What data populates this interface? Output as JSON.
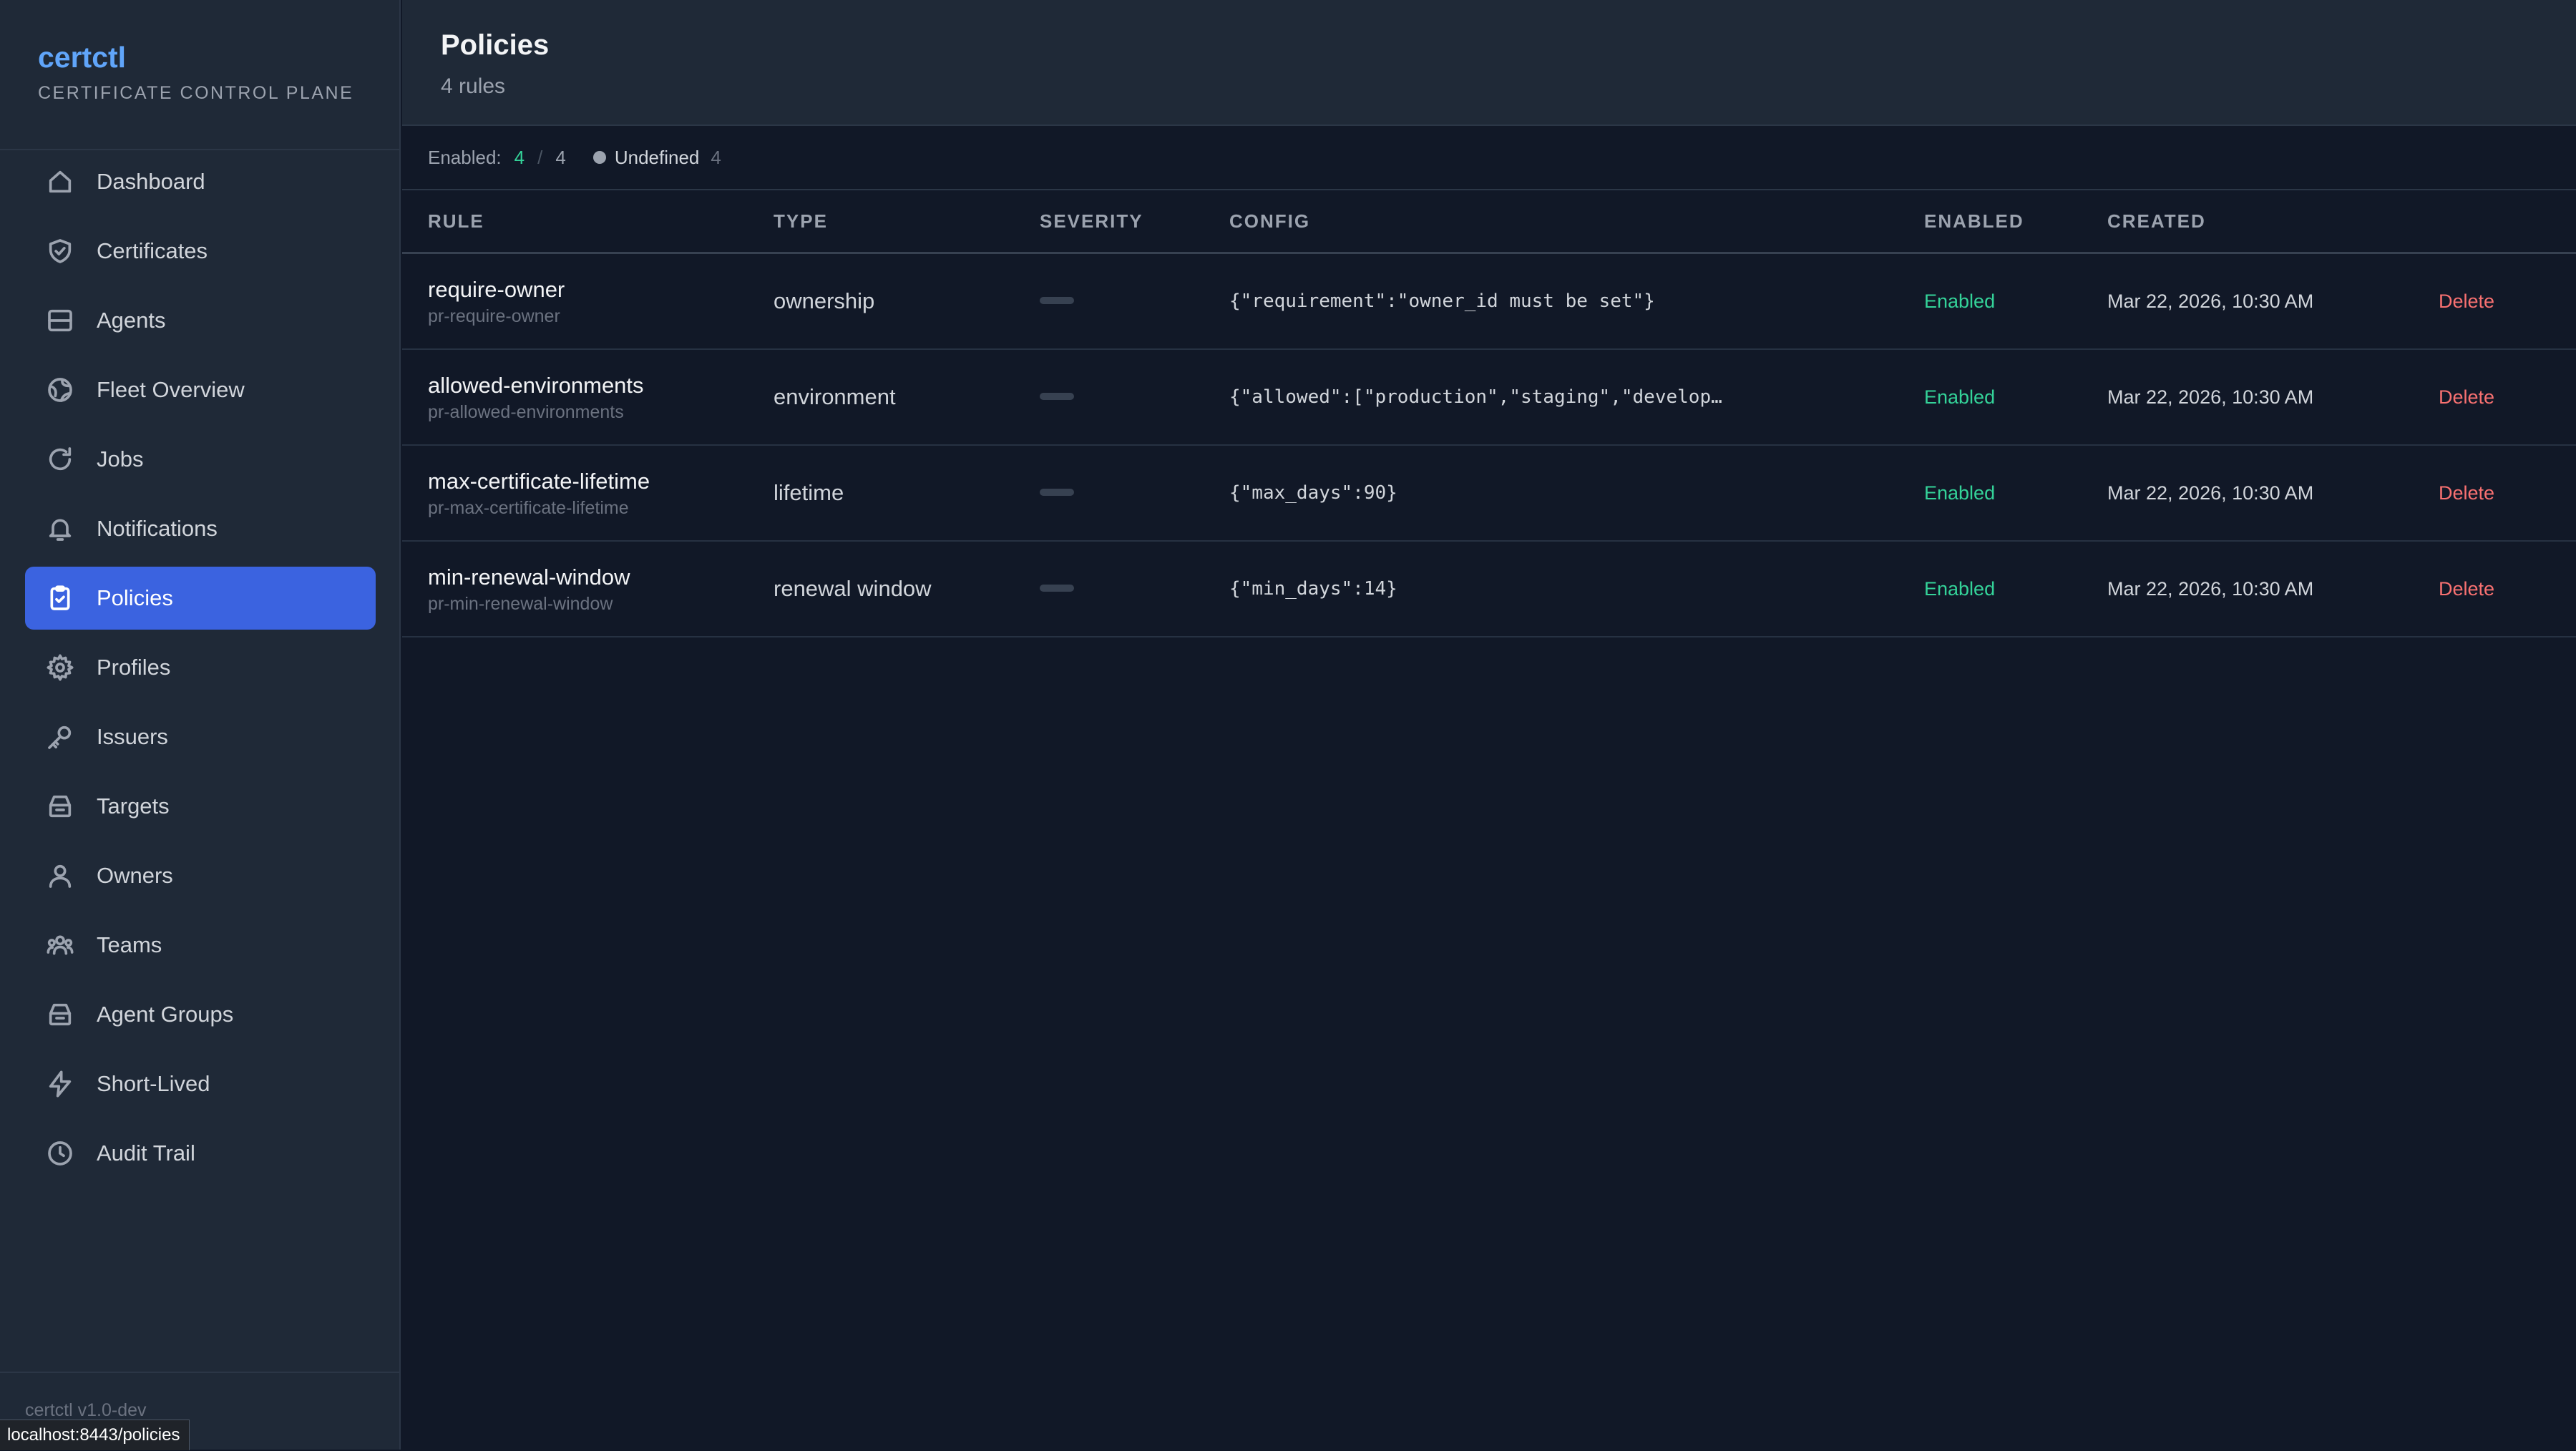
{
  "app": {
    "name": "certctl",
    "tagline": "CERTIFICATE CONTROL PLANE",
    "version": "certctl v1.0-dev"
  },
  "status_bar_url": "localhost:8443/policies",
  "sidebar": {
    "items": [
      {
        "label": "Dashboard",
        "icon": "home-icon",
        "active": false
      },
      {
        "label": "Certificates",
        "icon": "shield-check-icon",
        "active": false
      },
      {
        "label": "Agents",
        "icon": "server-icon",
        "active": false
      },
      {
        "label": "Fleet Overview",
        "icon": "globe-icon",
        "active": false
      },
      {
        "label": "Jobs",
        "icon": "refresh-icon",
        "active": false
      },
      {
        "label": "Notifications",
        "icon": "bell-icon",
        "active": false
      },
      {
        "label": "Policies",
        "icon": "clipboard-check-icon",
        "active": true
      },
      {
        "label": "Profiles",
        "icon": "gear-icon",
        "active": false
      },
      {
        "label": "Issuers",
        "icon": "key-icon",
        "active": false
      },
      {
        "label": "Targets",
        "icon": "stack-icon",
        "active": false
      },
      {
        "label": "Owners",
        "icon": "user-icon",
        "active": false
      },
      {
        "label": "Teams",
        "icon": "users-icon",
        "active": false
      },
      {
        "label": "Agent Groups",
        "icon": "stack-icon",
        "active": false
      },
      {
        "label": "Short-Lived",
        "icon": "bolt-icon",
        "active": false
      },
      {
        "label": "Audit Trail",
        "icon": "clock-icon",
        "active": false
      }
    ]
  },
  "header": {
    "title": "Policies",
    "subtitle": "4 rules"
  },
  "filters": {
    "enabled_label": "Enabled:",
    "enabled_count": "4",
    "separator": "/",
    "total_count": "4",
    "legend_label": "Undefined",
    "legend_count": "4"
  },
  "table": {
    "columns": [
      "RULE",
      "TYPE",
      "SEVERITY",
      "CONFIG",
      "ENABLED",
      "CREATED",
      ""
    ],
    "rows": [
      {
        "name": "require-owner",
        "id": "pr-require-owner",
        "type": "ownership",
        "config": "{\"requirement\":\"owner_id must be set\"}",
        "enabled": "Enabled",
        "created": "Mar 22, 2026, 10:30 AM",
        "action": "Delete"
      },
      {
        "name": "allowed-environments",
        "id": "pr-allowed-environments",
        "type": "environment",
        "config": "{\"allowed\":[\"production\",\"staging\",\"develop…",
        "enabled": "Enabled",
        "created": "Mar 22, 2026, 10:30 AM",
        "action": "Delete"
      },
      {
        "name": "max-certificate-lifetime",
        "id": "pr-max-certificate-lifetime",
        "type": "lifetime",
        "config": "{\"max_days\":90}",
        "enabled": "Enabled",
        "created": "Mar 22, 2026, 10:30 AM",
        "action": "Delete"
      },
      {
        "name": "min-renewal-window",
        "id": "pr-min-renewal-window",
        "type": "renewal window",
        "config": "{\"min_days\":14}",
        "enabled": "Enabled",
        "created": "Mar 22, 2026, 10:30 AM",
        "action": "Delete"
      }
    ]
  },
  "colors": {
    "accent": "#3b63e0",
    "brand": "#60a5fa",
    "enabled": "#34d399",
    "danger": "#f87171"
  }
}
